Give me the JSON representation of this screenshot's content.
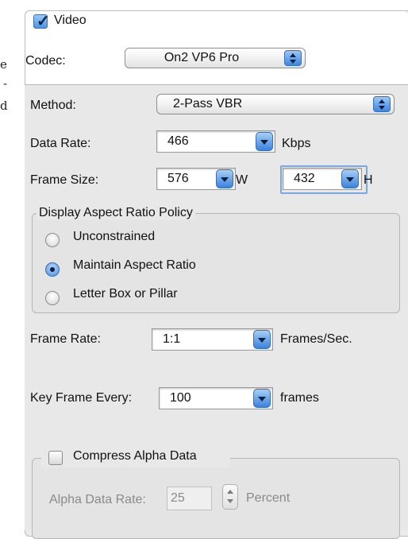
{
  "left_edge": {
    "lines": [
      "e",
      "-",
      "d"
    ]
  },
  "video": {
    "checkbox_label": "Video",
    "checked": true,
    "codec_label": "Codec:",
    "codec_value": "On2 VP6 Pro"
  },
  "settings": {
    "method_label": "Method:",
    "method_value": "2-Pass VBR",
    "data_rate_label": "Data Rate:",
    "data_rate_value": "466",
    "data_rate_unit": "Kbps",
    "frame_size_label": "Frame Size:",
    "width_value": "576",
    "width_unit": "W",
    "height_value": "432",
    "height_unit": "H",
    "frame_rate_label": "Frame Rate:",
    "frame_rate_value": "1:1",
    "frame_rate_unit": "Frames/Sec.",
    "key_frame_label": "Key Frame Every:",
    "key_frame_value": "100",
    "key_frame_unit": "frames"
  },
  "aspect_policy": {
    "title": "Display Aspect Ratio Policy",
    "options": [
      {
        "label": "Unconstrained",
        "selected": false
      },
      {
        "label": "Maintain Aspect Ratio",
        "selected": true
      },
      {
        "label": "Letter Box or Pillar",
        "selected": false
      }
    ]
  },
  "alpha": {
    "checkbox_label": "Compress Alpha Data",
    "checked": false,
    "rate_label": "Alpha Data Rate:",
    "rate_value": "25",
    "rate_unit": "Percent"
  }
}
